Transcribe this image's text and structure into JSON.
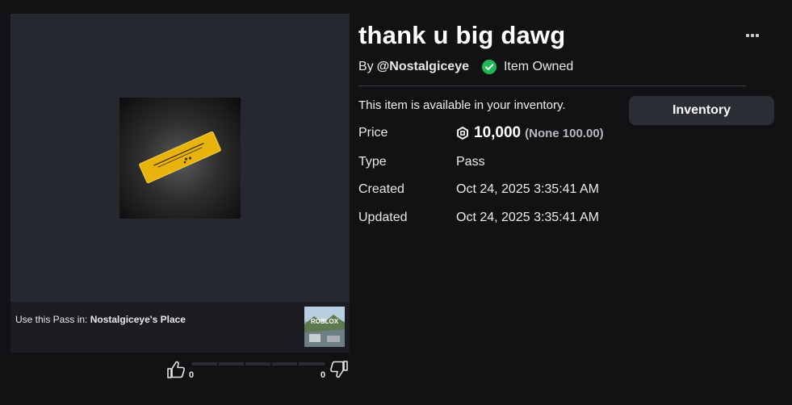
{
  "item": {
    "title": "thank u big dawg",
    "by_prefix": "By",
    "creator": "@Nostalgiceye",
    "owned_label": "Item Owned",
    "availability": "This item is available in your inventory.",
    "inventory_button": "Inventory",
    "thumbnail_icon": "pass-ticket-icon"
  },
  "use_pass": {
    "prefix": "Use this Pass in:",
    "place_name": "Nostalgiceye's Place",
    "place_thumbnail_label": "ROBLOX"
  },
  "details": {
    "price": {
      "label": "Price",
      "amount": "10,000",
      "note": "(None 100.00)"
    },
    "type": {
      "label": "Type",
      "value": "Pass"
    },
    "created": {
      "label": "Created",
      "value": "Oct 24, 2025 3:35:41 AM"
    },
    "updated": {
      "label": "Updated",
      "value": "Oct 24, 2025 3:35:41 AM"
    }
  },
  "votes": {
    "up_count": "0",
    "down_count": "0"
  },
  "colors": {
    "background": "#121215",
    "panel": "#25282f",
    "owned_green": "#1eb854",
    "ticket_gold": "#e6b40f",
    "button": "#2c2e36"
  }
}
